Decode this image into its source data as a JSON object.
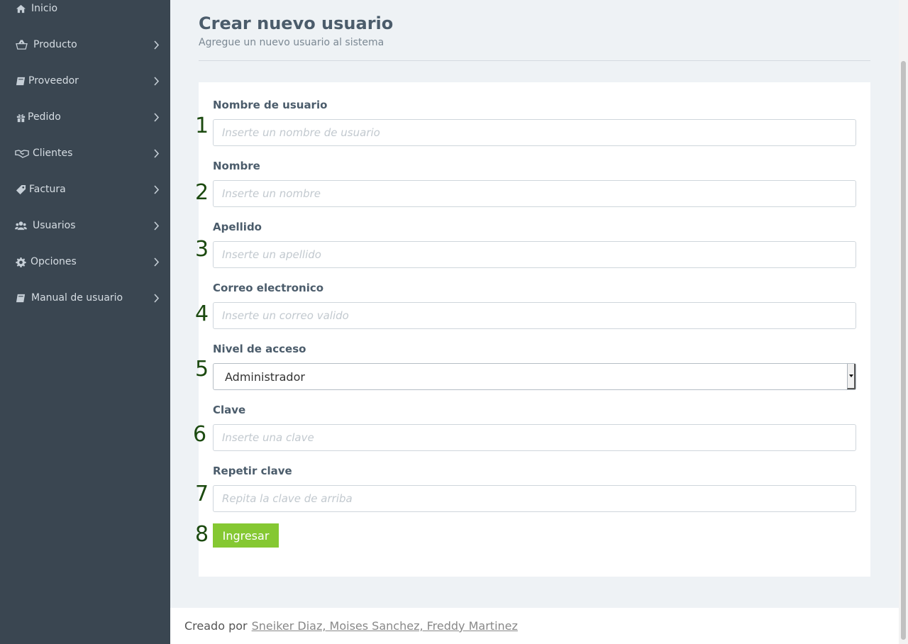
{
  "sidebar": {
    "items": [
      {
        "label": "Inicio",
        "icon": "home-icon",
        "has_submenu": false
      },
      {
        "label": "Producto",
        "icon": "basket-icon",
        "has_submenu": true
      },
      {
        "label": "Proveedor",
        "icon": "book-icon",
        "has_submenu": true
      },
      {
        "label": "Pedido",
        "icon": "gift-icon",
        "has_submenu": true
      },
      {
        "label": "Clientes",
        "icon": "handshake-icon",
        "has_submenu": true
      },
      {
        "label": "Factura",
        "icon": "tag-icon",
        "has_submenu": true
      },
      {
        "label": "Usuarios",
        "icon": "users-icon",
        "has_submenu": true
      },
      {
        "label": "Opciones",
        "icon": "gear-icon",
        "has_submenu": true
      },
      {
        "label": "Manual de usuario",
        "icon": "book-icon",
        "has_submenu": true
      }
    ]
  },
  "header": {
    "title": "Crear nuevo usuario",
    "subtitle": "Agregue un nuevo usuario al sistema"
  },
  "form": {
    "fields": [
      {
        "label": "Nombre de usuario",
        "placeholder": "Inserte un nombre de usuario",
        "value": "",
        "step": "1"
      },
      {
        "label": "Nombre",
        "placeholder": "Inserte un nombre",
        "value": "",
        "step": "2"
      },
      {
        "label": "Apellido",
        "placeholder": "Inserte un apellido",
        "value": "",
        "step": "3"
      },
      {
        "label": "Correo electronico",
        "placeholder": "Inserte un correo valido",
        "value": "",
        "step": "4"
      },
      {
        "label": "Nivel de acceso",
        "selected": "Administrador",
        "step": "5"
      },
      {
        "label": "Clave",
        "placeholder": "Inserte una clave",
        "value": "",
        "step": "6"
      },
      {
        "label": "Repetir clave",
        "placeholder": "Repita la clave de arriba",
        "value": "",
        "step": "7"
      }
    ],
    "submit_label": "Ingresar",
    "submit_step": "8"
  },
  "footer": {
    "prefix": "Creado por",
    "authors": "Sneiker Diaz, Moises Sanchez, Freddy Martinez"
  },
  "colors": {
    "sidebar_bg": "#3a4651",
    "page_bg": "#eef2f5",
    "accent_button": "#85c832",
    "step_number": "#1c4a10"
  }
}
